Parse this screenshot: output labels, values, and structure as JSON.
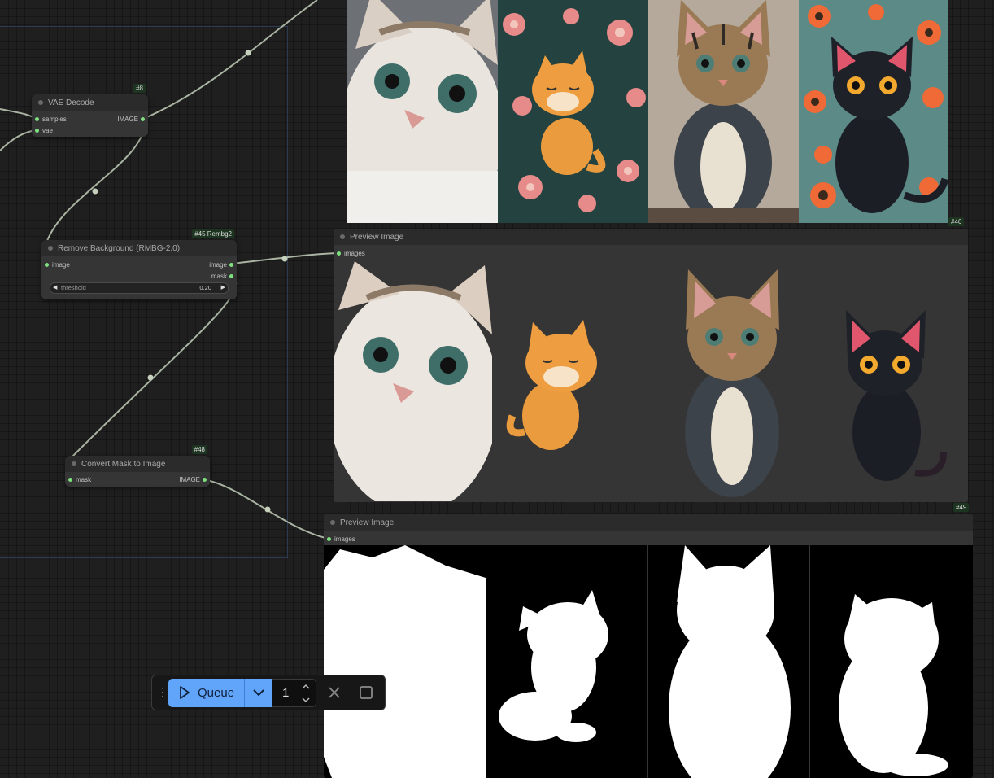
{
  "nodes": {
    "vae_decode": {
      "id": "#8",
      "title": "VAE Decode",
      "inputs": [
        "samples",
        "vae"
      ],
      "outputs": [
        "IMAGE"
      ]
    },
    "remove_bg": {
      "id": "#45 Rembg2",
      "title": "Remove Background (RMBG-2.0)",
      "inputs": [
        "image"
      ],
      "outputs": [
        "image",
        "mask"
      ],
      "widget": {
        "name": "threshold",
        "value": "0.20"
      }
    },
    "mask_to_image": {
      "id": "#48",
      "title": "Convert Mask to Image",
      "inputs": [
        "mask"
      ],
      "outputs": [
        "IMAGE"
      ]
    },
    "preview_1": {
      "id": "#46",
      "title": "Preview Image",
      "inputs": [
        "images"
      ]
    },
    "preview_2": {
      "id": "#49",
      "title": "Preview Image",
      "inputs": [
        "images"
      ]
    }
  },
  "queue": {
    "label": "Queue",
    "batch_count": "1"
  },
  "icons": {
    "play": "play-icon",
    "chevron": "chevron-down-icon",
    "stepper": "stepper-icon",
    "cancel": "close-icon",
    "stop": "stop-icon",
    "drag": "drag-handle-icon"
  },
  "colors": {
    "canvas": "#1f1f1f",
    "node_body": "#353535",
    "node_header": "#2b2b2b",
    "slot_connected": "#7fe07f",
    "wire": "#b8c5b0",
    "queue_accent": "#60a5fa"
  }
}
